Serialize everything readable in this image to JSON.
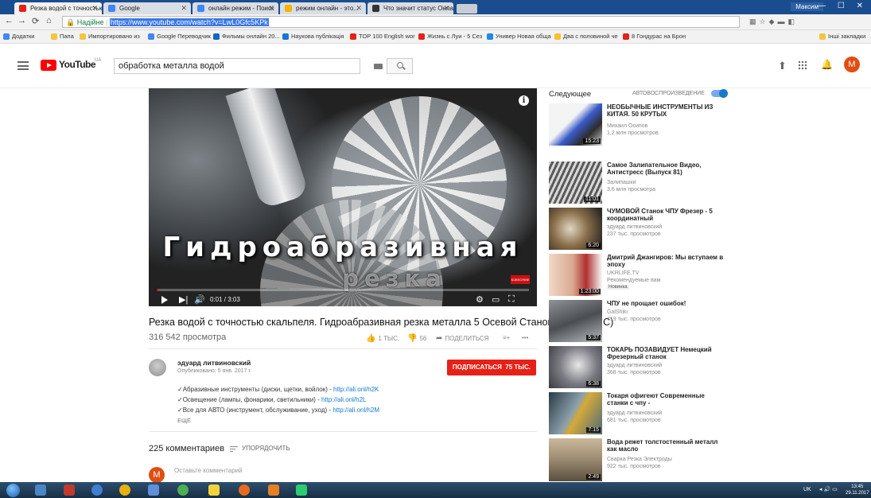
{
  "browser": {
    "tabs": [
      {
        "title": "Резка водой с точностью",
        "color": "#e62117"
      },
      {
        "title": "Google",
        "color": "#4285f4"
      },
      {
        "title": "онлайн режим - Поиск",
        "color": "#4285f4"
      },
      {
        "title": "режим онлайн - это...",
        "color": "#f4b400"
      },
      {
        "title": "Что значит статус Онлайн",
        "color": "#333333"
      }
    ],
    "user": "Максим",
    "window_controls": "— ☐ ✕",
    "secure_label": "Надійне",
    "url": "https://www.youtube.com/watch?v=LwL0Gfc5KPk",
    "bookmarks": [
      {
        "label": "Додатки",
        "color": "#4285f4"
      },
      {
        "label": "Папа",
        "color": "#f4c542"
      },
      {
        "label": "Импортировано из",
        "color": "#f4c542"
      },
      {
        "label": "Google Переводчик",
        "color": "#4285f4"
      },
      {
        "label": "Фильмы онлайн 20...",
        "color": "#1565c0"
      },
      {
        "label": "Наукова публікація",
        "color": "#1976d2"
      },
      {
        "label": "TOP 100 English wor",
        "color": "#e62117"
      },
      {
        "label": "Жизнь с Луи - 5 Сез",
        "color": "#e62117"
      },
      {
        "label": "Универ Новая обща",
        "color": "#1e88e5"
      },
      {
        "label": "Два с половиной че",
        "color": "#fbc02d"
      },
      {
        "label": "8 Гондурас на Брон",
        "color": "#e62117"
      },
      {
        "label": "Інші закладки",
        "color": "#f4c542"
      }
    ]
  },
  "header": {
    "logo": "YouTube",
    "region": "UA",
    "search_value": "обработка металла водой",
    "avatar_letter": "M",
    "accent": "#e24d12"
  },
  "player": {
    "overlay_line_1": "Гидроабразивная",
    "overlay_line_2": "резка",
    "info_label": "i",
    "badge": "SUBSCRIBE",
    "time": "0:01 / 3:03",
    "progress": 0.005
  },
  "video": {
    "title": "Резка водой с точностью скальпеля. Гидроабразивная резка металла 5 Осевой Станок с ЧПУ (CNC)",
    "views": "316 542 просмотра",
    "likes": "1 ТЫС.",
    "dislikes": "56",
    "share": "ПОДЕЛИТЬСЯ",
    "more_actions": "•••"
  },
  "channel": {
    "name": "эдуард литвиновский",
    "published": "Опубликовано: 5 янв. 2017 г.",
    "subscribe": "ПОДПИСАТЬСЯ",
    "subscribers": "75 ТЫС."
  },
  "description": [
    {
      "text": "✓Абразивные инструменты (диски, щетки, войлок) - ",
      "link": "http://ali.onl/h2K"
    },
    {
      "text": "✓Освещение (лампы, фонарики, светильники) - ",
      "link": "http://ali.onl/h2L"
    },
    {
      "text": "✓Все для АВТО (инструмент, обслуживание, уход) - ",
      "link": "http://ali.onl/h2M"
    }
  ],
  "description_more": "ЕЩЁ",
  "comments": {
    "count": "225 комментариев",
    "sort": "УПОРЯДОЧИТЬ",
    "placeholder": "Оставьте комментарий",
    "avatar_letter": "M"
  },
  "sidebar": {
    "up_next": "Следующее",
    "autoplay": "АВТОВОСПРОИЗВЕДЕНИЕ",
    "items": [
      {
        "title": "НЕОБЫЧНЫЕ ИНСТРУМЕНТЫ ИЗ КИТАЯ. 50 КРУТЫХ",
        "channel": "Михаил Осипов",
        "views": "1,2 млн просмотров",
        "duration": "15:23",
        "thumb_color": "#3b5cc9"
      },
      {
        "title": "Самое Залипательное Видео, Антистресс (Выпуск 81)",
        "channel": "Залипашки",
        "views": "3,6 млн просмотра",
        "duration": "11:01",
        "thumb_color": "#6f6f6f"
      },
      {
        "title": "ЧУМОВОЙ Станок ЧПУ Фрезер - 5 координатный",
        "channel": "эдуард литвиновский",
        "views": "237 тыс. просмотров",
        "duration": "6:20",
        "thumb_color": "#8a6f4a"
      },
      {
        "title": "Дмитрий Джангиров: Мы вступаем в эпоху",
        "channel": "UKRLIFE.TV",
        "views": "Рекомендуемые вам",
        "duration": "1:23:00",
        "badge": "Новинка",
        "thumb_color": "#b03030"
      },
      {
        "title": "ЧПУ не прощает ошибок!",
        "channel": "GalShiki",
        "views": "719 тыс. просмотров",
        "duration": "5:37",
        "thumb_color": "#5a5a5a"
      },
      {
        "title": "ТОКАРЬ ПОЗАВИДУЕТ Немецкий Фрезерный станок",
        "channel": "эдуард литвиновский",
        "views": "368 тыс. просмотров",
        "duration": "6:38",
        "thumb_color": "#7a7a82"
      },
      {
        "title": "Токаря офигеют Современные станки с чпу -",
        "channel": "эдуард литвиновский",
        "views": "681 тыс. просмотров",
        "duration": "7:15",
        "thumb_color": "#4d6a7a"
      },
      {
        "title": "Вода режет толстостенный металл как масло",
        "channel": "Сварка Резка Электроды",
        "views": "922 тыс. просмотров",
        "duration": "2:49",
        "thumb_color": "#9a8a70"
      }
    ]
  },
  "taskbar": {
    "lang": "UK",
    "time": "13:45",
    "date": "29.11.2017"
  }
}
